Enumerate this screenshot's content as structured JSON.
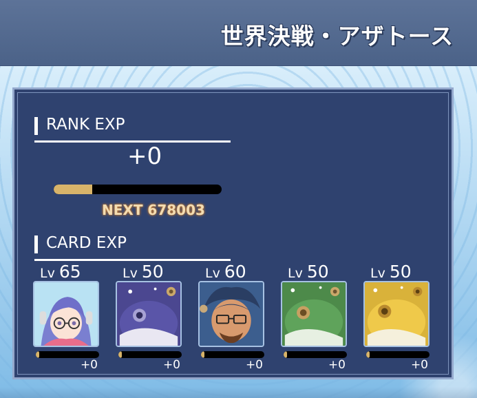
{
  "header": {
    "title": "世界決戦・アザトース"
  },
  "rank": {
    "label": "RANK EXP",
    "value": "+0",
    "progress": 0.23,
    "next": "NEXT 678003"
  },
  "card_section": {
    "label": "CARD EXP"
  },
  "cards": [
    {
      "lv_prefix": "Lv",
      "level": "65",
      "exp": "+0",
      "progress": 0.05,
      "portrait": "girl-with-glasses-portrait"
    },
    {
      "lv_prefix": "Lv",
      "level": "50",
      "exp": "+0",
      "progress": 0.05,
      "portrait": "purple-blob-creature-portrait"
    },
    {
      "lv_prefix": "Lv",
      "level": "60",
      "exp": "+0",
      "progress": 0.05,
      "portrait": "man-with-glasses-portrait"
    },
    {
      "lv_prefix": "Lv",
      "level": "50",
      "exp": "+0",
      "progress": 0.05,
      "portrait": "green-blob-creature-portrait"
    },
    {
      "lv_prefix": "Lv",
      "level": "50",
      "exp": "+0",
      "progress": 0.05,
      "portrait": "yellow-blob-creature-portrait"
    }
  ],
  "colors": {
    "panel": "#2f426f",
    "header": "#4f668c",
    "exp_fill": "#d8b46a"
  }
}
